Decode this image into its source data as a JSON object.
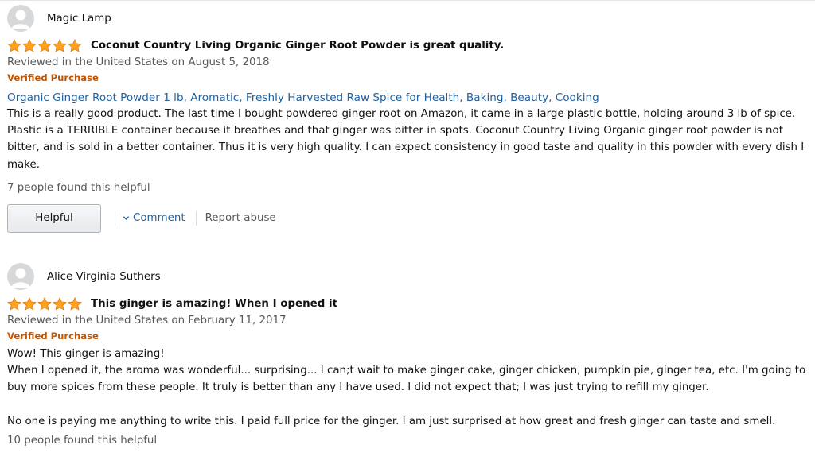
{
  "reviews": [
    {
      "author": "Magic Lamp",
      "rating": 5,
      "title": "Coconut Country Living Organic Ginger Root Powder is great quality.",
      "date": "Reviewed in the United States on August 5, 2018",
      "verified": "Verified Purchase",
      "product_link": "Organic Ginger Root Powder 1 lb, Aromatic, Freshly Harvested Raw Spice for Health, Baking, Beauty, Cooking",
      "body": "This is a really good product. The last time I bought powdered ginger root on Amazon, it came in a large plastic bottle, holding around 3 lb of spice. Plastic is a TERRIBLE container because it breathes and that ginger was bitter in spots. Coconut Country Living Organic ginger root powder is not bitter, and is sold in a better container. Thus it is very high quality. I can expect consistency in good taste and quality in this powder with every dish I make.",
      "helpful_count": "7 people found this helpful",
      "helpful_button": "Helpful",
      "comment_link": "Comment",
      "report_link": "Report abuse"
    },
    {
      "author": "Alice Virginia Suthers",
      "rating": 5,
      "title": "This ginger is amazing! When I opened it",
      "date": "Reviewed in the United States on February 11, 2017",
      "verified": "Verified Purchase",
      "body": "Wow! This ginger is amazing!\nWhen I opened it, the aroma was wonderful... surprising... I can;t wait to make ginger cake, ginger chicken, pumpkin pie, ginger tea, etc. I'm going to buy more spices from these people. It truly is better than any I have used. I did not expect that; I was just trying to refill my ginger.\n\nNo one is paying me anything to write this. I paid full price for the ginger. I am just surprised at how great and fresh ginger can taste and smell.",
      "helpful_count": "10 people found this helpful"
    }
  ],
  "colors": {
    "star": "#ffa41c",
    "star_stroke": "#de7921",
    "link": "#2162a1",
    "verified": "#c45500",
    "muted": "#565959"
  },
  "icons": {
    "avatar": "default-profile-avatar-icon",
    "star": "star-icon",
    "chevron": "chevron-down-icon"
  }
}
